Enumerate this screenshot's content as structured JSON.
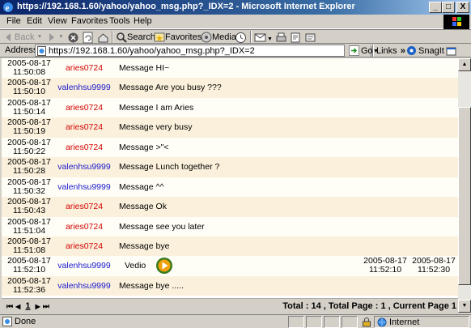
{
  "window": {
    "title": "https://192.168.1.60/yahoo/yahoo_msg.php?_IDX=2 - Microsoft Internet Explorer",
    "minimize": "_",
    "maximize": "□",
    "close": "X"
  },
  "menu": [
    "File",
    "Edit",
    "View",
    "Favorites",
    "Tools",
    "Help"
  ],
  "toolbar": {
    "back": "Back",
    "search": "Search",
    "favorites": "Favorites",
    "media": "Media"
  },
  "address": {
    "label": "Address",
    "url": "https://192.168.1.60/yahoo/yahoo_msg.php?_IDX=2",
    "go": "Go",
    "links": "Links",
    "snagit": "SnagIt"
  },
  "rows": [
    {
      "date": "2005-08-17",
      "time": "11:50:08",
      "user": "aries0724",
      "color": "red",
      "message": "Message HI~"
    },
    {
      "date": "2005-08-17",
      "time": "11:50:10",
      "user": "valenhsu9999",
      "color": "blue",
      "message": "Message Are you busy ???"
    },
    {
      "date": "2005-08-17",
      "time": "11:50:14",
      "user": "aries0724",
      "color": "red",
      "message": "Message I am Aries"
    },
    {
      "date": "2005-08-17",
      "time": "11:50:19",
      "user": "aries0724",
      "color": "red",
      "message": "Message very busy"
    },
    {
      "date": "2005-08-17",
      "time": "11:50:22",
      "user": "aries0724",
      "color": "red",
      "message": "Message >\"<"
    },
    {
      "date": "2005-08-17",
      "time": "11:50:28",
      "user": "valenhsu9999",
      "color": "blue",
      "message": "Message Lunch together ?"
    },
    {
      "date": "2005-08-17",
      "time": "11:50:32",
      "user": "valenhsu9999",
      "color": "blue",
      "message": "Message ^^"
    },
    {
      "date": "2005-08-17",
      "time": "11:50:43",
      "user": "aries0724",
      "color": "red",
      "message": "Message Ok"
    },
    {
      "date": "2005-08-17",
      "time": "11:51:04",
      "user": "aries0724",
      "color": "red",
      "message": "Message see you later"
    },
    {
      "date": "2005-08-17",
      "time": "11:51:08",
      "user": "aries0724",
      "color": "red",
      "message": "Message bye"
    }
  ],
  "video_row": {
    "date": "2005-08-17",
    "time": "11:52:10",
    "user": "valenhsu9999",
    "label": "Vedio",
    "start_date": "2005-08-17",
    "start_time": "11:52:10",
    "end_date": "2005-08-17",
    "end_time": "11:52:30"
  },
  "last_row": {
    "date": "2005-08-17",
    "time": "11:52:36",
    "user": "valenhsu9999",
    "message": "Message bye ....."
  },
  "footer": {
    "first": "⏮",
    "prev": "◀",
    "page": "1",
    "next": "▶",
    "last": "⏭",
    "totals": "Total : 14 , Total Page : 1 , Current Page 1"
  },
  "status": {
    "text": "Done",
    "zone": "Internet"
  },
  "colors": {
    "red": "#d40000",
    "blue": "#1a1ad0",
    "row_even": "#fffef6",
    "row_odd": "#faf0db"
  }
}
